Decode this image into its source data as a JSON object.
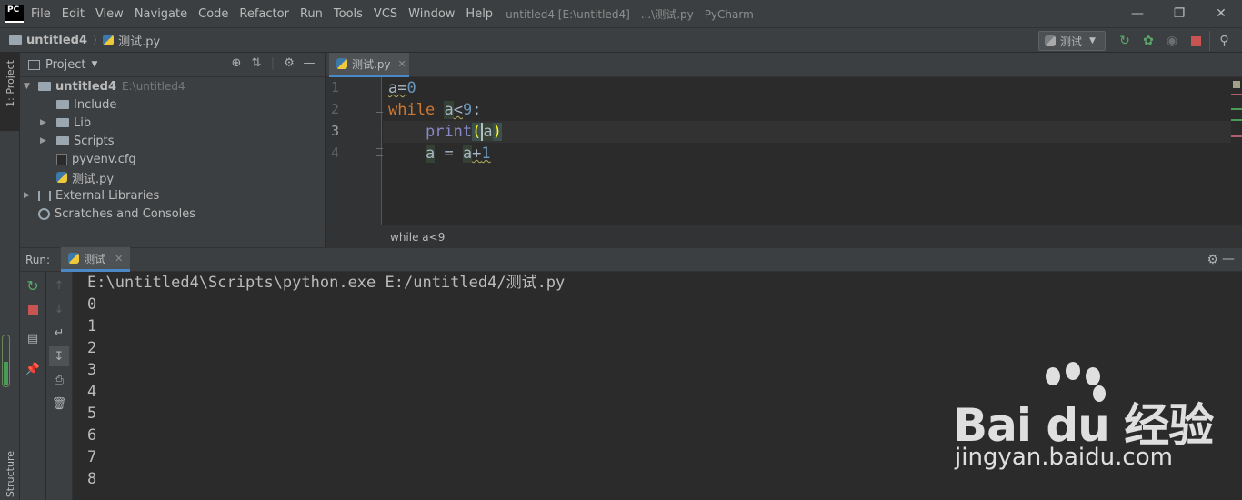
{
  "app": {
    "logo_text": "PC",
    "menu": [
      "File",
      "Edit",
      "View",
      "Navigate",
      "Code",
      "Refactor",
      "Run",
      "Tools",
      "VCS",
      "Window",
      "Help"
    ],
    "window_title": "untitled4 [E:\\untitled4] - ...\\测试.py - PyCharm"
  },
  "navbar": {
    "project": "untitled4",
    "file": "测试.py",
    "run_config": "测试"
  },
  "left_strip": {
    "project_tab": "1: Project",
    "structure_tab": "Structure"
  },
  "project_panel": {
    "title": "Project",
    "tree": [
      {
        "label": "untitled4",
        "hint": "E:\\untitled4"
      },
      {
        "label": "Include"
      },
      {
        "label": "Lib"
      },
      {
        "label": "Scripts"
      },
      {
        "label": "pyvenv.cfg"
      },
      {
        "label": "测试.py"
      },
      {
        "label": "External Libraries"
      },
      {
        "label": "Scratches and Consoles"
      }
    ]
  },
  "editor": {
    "tab": "测试.py",
    "line_numbers": [
      "1",
      "2",
      "3",
      "4"
    ],
    "breadcrumb": "while a<9"
  },
  "run_panel": {
    "label": "Run:",
    "tab": "测试",
    "command": "E:\\untitled4\\Scripts\\python.exe E:/untitled4/测试.py",
    "output": [
      "0",
      "1",
      "2",
      "3",
      "4",
      "5",
      "6",
      "7",
      "8"
    ]
  },
  "watermark": {
    "brand": "Bai du 经验",
    "url": "jingyan.baidu.com"
  },
  "colors": {
    "background": "#2b2b2b",
    "panel": "#3c3f41",
    "keyword": "#cc7832",
    "number": "#6897bb",
    "builtin": "#8888c6",
    "accent": "#4a88c7"
  }
}
